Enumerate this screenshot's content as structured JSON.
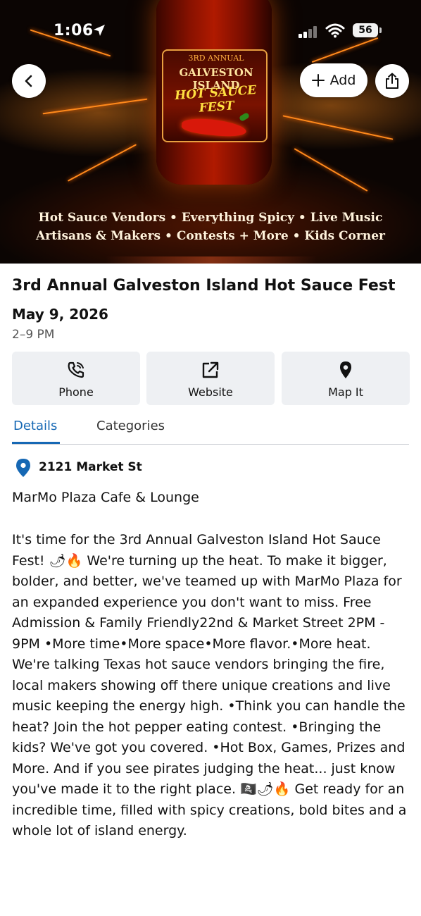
{
  "status_bar": {
    "time": "1:06",
    "battery": "56"
  },
  "hero": {
    "label_line1": "3RD ANNUAL",
    "label_line2": "GALVESTON ISLAND",
    "label_line3": "HOT SAUCE FEST",
    "tagline1": "Hot Sauce Vendors • Everything Spicy • Live Music",
    "tagline2": "Artisans & Makers • Contests + More • Kids Corner",
    "add_label": "Add"
  },
  "event": {
    "title": "3rd Annual Galveston Island Hot Sauce Fest",
    "date": "May 9, 2026",
    "time": "2–9 PM"
  },
  "actions": {
    "phone": "Phone",
    "website": "Website",
    "map": "Map It"
  },
  "tabs": {
    "details": "Details",
    "categories": "Categories"
  },
  "details": {
    "address": "2121 Market St",
    "venue": "MarMo Plaza Cafe & Lounge",
    "description": "It's time for the 3rd Annual Galveston Island Hot Sauce Fest! 🌶🔥 We're turning up the heat. To make it bigger, bolder, and better, we've teamed up with MarMo Plaza for an expanded experience you don't want to miss.  Free Admission & Family Friendly22nd & Market Street 2PM - 9PM •More time•More space•More flavor.•More heat. We're talking Texas hot sauce vendors bringing the fire, local makers showing off there unique creations and live music keeping the energy high. •Think you can handle the heat? Join the hot pepper eating contest. •Bringing the kids? We've got you covered. •Hot Box, Games, Prizes and More. And if you see pirates judging the heat... just know you've made it to the right place. 🏴‍☠️🌶🔥 Get ready for an incredible time, filled with spicy creations, bold bites and a whole lot of island energy."
  },
  "colors": {
    "accent": "#1668b4",
    "button_bg": "#eef0f3"
  }
}
